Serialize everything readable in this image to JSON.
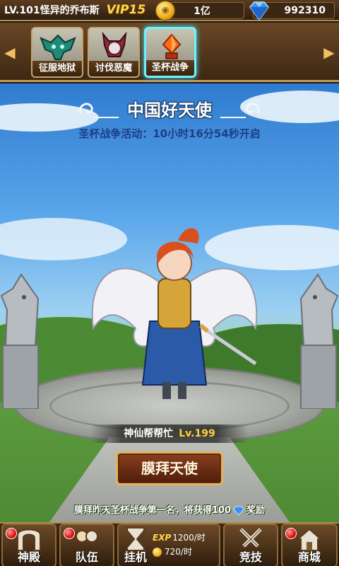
{
  "status_bar": {
    "level": "LV.101",
    "player_name": "怪异的乔布斯",
    "vip": "VIP15",
    "gold": "1亿",
    "diamonds": "992310"
  },
  "tabs": [
    {
      "label": "征服地狱",
      "active": false
    },
    {
      "label": "讨伐恶魔",
      "active": false
    },
    {
      "label": "圣杯战争",
      "active": true
    }
  ],
  "event": {
    "title": "中国好天使",
    "countdown": "圣杯战争活动：10小时16分54秒开启"
  },
  "angel": {
    "name": "神仙帮帮忙",
    "level": "Lv.199"
  },
  "worship_button": "膜拜天使",
  "reward": {
    "prefix": "膜拜昨天圣杯战争第一名，将获得100",
    "suffix": "奖励"
  },
  "bottom_nav": {
    "temple": "神殿",
    "team": "队伍",
    "idle": "挂机",
    "idle_exp_label": "EXP",
    "idle_exp_rate": "1200/时",
    "idle_gold_rate": "720/时",
    "arena": "竞技",
    "shop": "商城"
  },
  "colors": {
    "frame_gold": "#c59a54",
    "active_tab_glow": "#6ff2ff",
    "vip_yellow": "#ffd84a",
    "countdown_blue": "#1e3d86"
  }
}
